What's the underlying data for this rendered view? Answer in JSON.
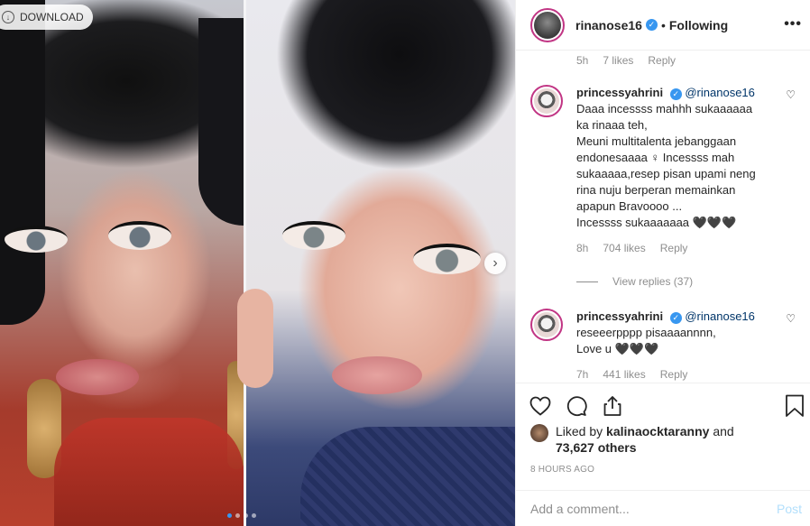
{
  "media": {
    "download_label": "DOWNLOAD",
    "carousel_dots": 4,
    "active_dot": 1
  },
  "header": {
    "username": "rinanose16",
    "separator": "•",
    "follow_status": "Following",
    "more": "•••"
  },
  "top_comment_meta": {
    "time": "5h",
    "likes": "7 likes",
    "reply": "Reply"
  },
  "comments": [
    {
      "username": "princessyahrini",
      "mention": "@rinanose16",
      "text": "Daaa incessss mahhh sukaaaaaa\nka rinaaa teh,\nMeuni multitalenta jebanggaan\nendonesaaaa ♀ Incessss mah\nsukaaaaa,resep pisan upami neng\nrina nuju berperan memainkan\napapun Bravoooo ...\nIncessss sukaaaaaaa 🖤🖤🖤",
      "time": "8h",
      "likes": "704 likes",
      "reply": "Reply"
    },
    {
      "username": "princessyahrini",
      "mention": "@rinanose16",
      "text": "reseeerpppp pisaaaannnn,\nLove u 🖤🖤🖤",
      "time": "7h",
      "likes": "441 likes",
      "reply": "Reply"
    }
  ],
  "view_replies": "View replies (37)",
  "likes": {
    "prefix": "Liked by",
    "user": "kalinaocktaranny",
    "middle": "and",
    "count": "73,627 others"
  },
  "timestamp": "8 HOURS AGO",
  "add_comment": {
    "placeholder": "Add a comment...",
    "post_label": "Post"
  },
  "colors": {
    "accent_blue": "#3897f0",
    "post_disabled": "#b2dffc",
    "muted": "#8e8e8e",
    "story_ring": "#c13584"
  }
}
